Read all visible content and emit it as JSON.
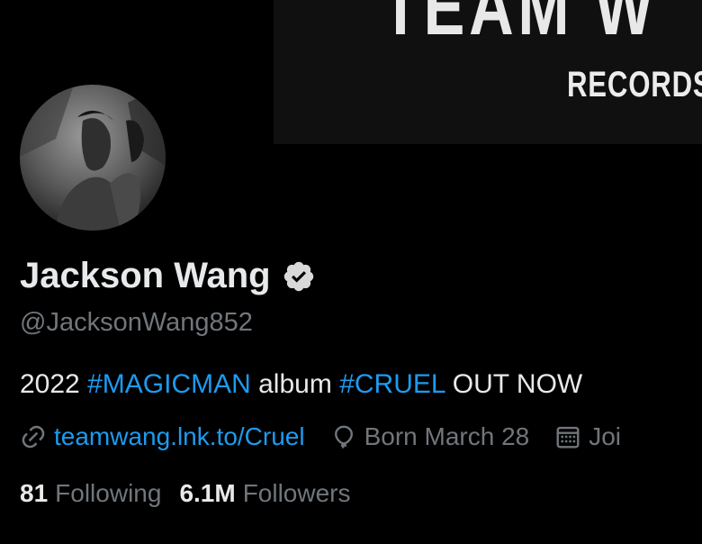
{
  "banner": {
    "brand_text": "TEAM W",
    "sub_text": "RECORDS"
  },
  "profile": {
    "display_name": "Jackson Wang",
    "verified": true,
    "handle": "@JacksonWang852",
    "bio": {
      "year": "2022",
      "tag1": "#MAGICMAN",
      "word": "album",
      "tag2": "#CRUEL",
      "tail": "OUT NOW"
    },
    "meta": {
      "link": "teamwang.lnk.to/Cruel",
      "born": "Born March 28",
      "joined_partial": "Joi"
    },
    "counts": {
      "following_num": "81",
      "following_label": "Following",
      "followers_num": "6.1M",
      "followers_label": "Followers"
    }
  },
  "icons": {
    "verified": "verified-badge-icon",
    "link": "link-icon",
    "born": "balloon-icon",
    "joined": "calendar-icon"
  },
  "colors": {
    "background": "#000000",
    "primary_text": "#e7e9ea",
    "secondary_text": "#71767b",
    "accent": "#1d9bf0"
  }
}
